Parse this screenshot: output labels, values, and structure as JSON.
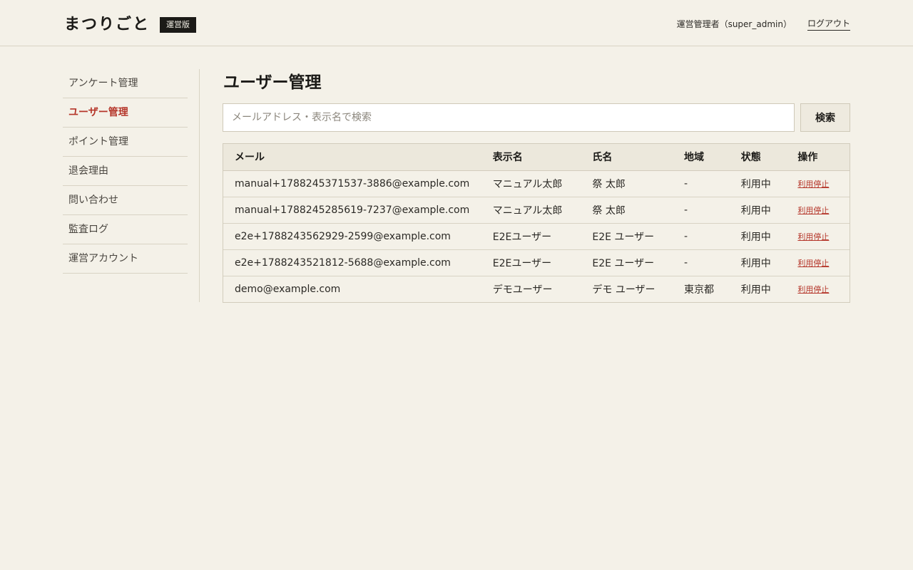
{
  "header": {
    "logo": "まつりごと",
    "badge": "運営版",
    "admin_label": "運営管理者（super_admin）",
    "logout_label": "ログアウト"
  },
  "sidebar": {
    "items": [
      {
        "label": "アンケート管理",
        "active": false
      },
      {
        "label": "ユーザー管理",
        "active": true
      },
      {
        "label": "ポイント管理",
        "active": false
      },
      {
        "label": "退会理由",
        "active": false
      },
      {
        "label": "問い合わせ",
        "active": false
      },
      {
        "label": "監査ログ",
        "active": false
      },
      {
        "label": "運営アカウント",
        "active": false
      }
    ]
  },
  "main": {
    "title": "ユーザー管理",
    "search": {
      "placeholder": "メールアドレス・表示名で検索",
      "value": "",
      "button_label": "検索"
    },
    "table": {
      "headers": [
        "メール",
        "表示名",
        "氏名",
        "地域",
        "状態",
        "操作"
      ],
      "rows": [
        {
          "email": "manual+1788245371537-3886@example.com",
          "display_name": "マニュアル太郎",
          "full_name": "祭 太郎",
          "region": "-",
          "status": "利用中",
          "action": "利用停止"
        },
        {
          "email": "manual+1788245285619-7237@example.com",
          "display_name": "マニュアル太郎",
          "full_name": "祭 太郎",
          "region": "-",
          "status": "利用中",
          "action": "利用停止"
        },
        {
          "email": "e2e+1788243562929-2599@example.com",
          "display_name": "E2Eユーザー",
          "full_name": "E2E ユーザー",
          "region": "-",
          "status": "利用中",
          "action": "利用停止"
        },
        {
          "email": "e2e+1788243521812-5688@example.com",
          "display_name": "E2Eユーザー",
          "full_name": "E2E ユーザー",
          "region": "-",
          "status": "利用中",
          "action": "利用停止"
        },
        {
          "email": "demo@example.com",
          "display_name": "デモユーザー",
          "full_name": "デモ ユーザー",
          "region": "東京都",
          "status": "利用中",
          "action": "利用停止"
        }
      ]
    }
  },
  "colors": {
    "background": "#f4f1e8",
    "accent": "#b5362a",
    "badge_bg": "#1b1a17"
  }
}
